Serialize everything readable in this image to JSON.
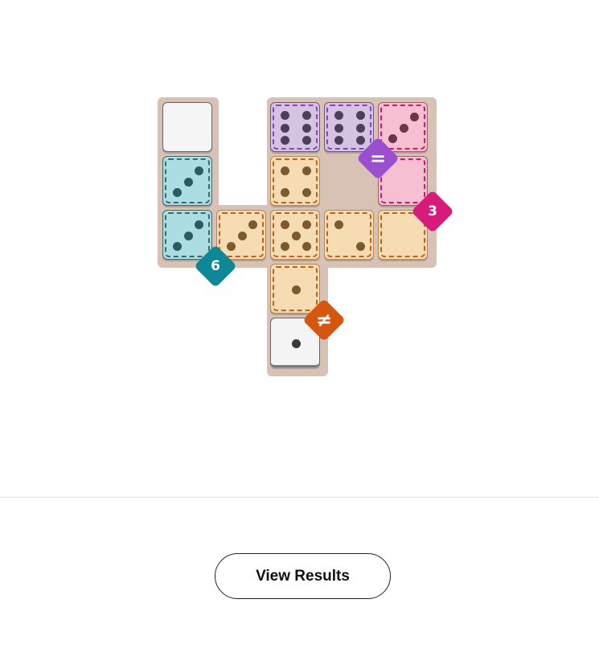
{
  "board": {
    "cells": [
      {
        "col": 0,
        "row": 0,
        "color": "empty",
        "pips": 0
      },
      {
        "col": 0,
        "row": 1,
        "color": "teal",
        "pips": 3
      },
      {
        "col": 0,
        "row": 2,
        "color": "teal",
        "pips": 3
      },
      {
        "col": 1,
        "row": 2,
        "color": "orange",
        "pips": 3
      },
      {
        "col": 2,
        "row": 0,
        "color": "purple",
        "pips": 6
      },
      {
        "col": 3,
        "row": 0,
        "color": "purple",
        "pips": 6
      },
      {
        "col": 4,
        "row": 0,
        "color": "pink",
        "pips": 3
      },
      {
        "col": 2,
        "row": 1,
        "color": "orange",
        "pips": 4
      },
      {
        "col": 4,
        "row": 1,
        "color": "pink",
        "pips": 0
      },
      {
        "col": 2,
        "row": 2,
        "color": "orange",
        "pips": 5
      },
      {
        "col": 3,
        "row": 2,
        "color": "orange",
        "pips": 2
      },
      {
        "col": 4,
        "row": 2,
        "color": "orange",
        "pips": 0
      },
      {
        "col": 2,
        "row": 3,
        "color": "orange",
        "pips": 1
      },
      {
        "col": 2,
        "row": 4,
        "color": "white",
        "pips": 1
      }
    ],
    "regions": [
      {
        "name": "teal",
        "label": "6",
        "color": "#0e8796"
      },
      {
        "name": "purple",
        "label": "=",
        "color": "#9a4fd0"
      },
      {
        "name": "pink",
        "label": "3",
        "color": "#d81b7a"
      },
      {
        "name": "orange",
        "label": "≠",
        "color": "#d4560f"
      }
    ]
  },
  "footer": {
    "view_results_label": "View Results"
  }
}
